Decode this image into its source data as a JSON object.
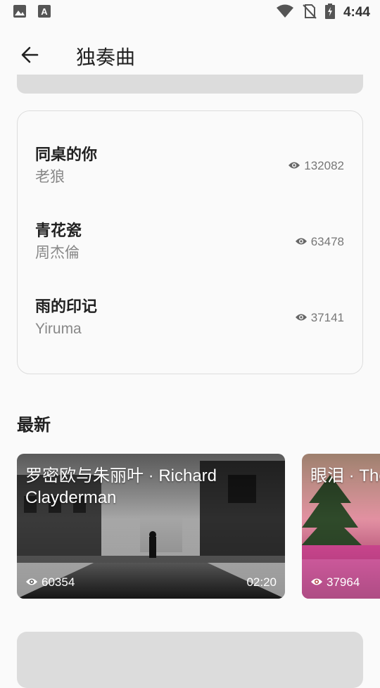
{
  "status_bar": {
    "time": "4:44",
    "left_icons": [
      "image-icon",
      "text-a-icon"
    ],
    "right_icons": [
      "wifi-icon",
      "no-sim-icon",
      "battery-charging-icon"
    ]
  },
  "app_bar": {
    "back_icon": "arrow-left-icon",
    "title": "独奏曲"
  },
  "songs": [
    {
      "title": "同桌的你",
      "artist": "老狼",
      "views": "132082"
    },
    {
      "title": "青花瓷",
      "artist": "周杰倫",
      "views": "63478"
    },
    {
      "title": "雨的印记",
      "artist": "Yiruma",
      "views": "37141"
    }
  ],
  "latest": {
    "title": "最新",
    "videos": [
      {
        "title": "罗密欧与朱丽叶 · Richard Clayderman",
        "views": "60354",
        "duration": "02:20"
      },
      {
        "title": "眼泪 · The",
        "views": "37964",
        "duration": ""
      }
    ]
  },
  "colors": {
    "background": "#fafafa",
    "placeholder_gray": "#dcdcdc",
    "card_border": "#dddddd",
    "secondary_text": "#888888"
  }
}
